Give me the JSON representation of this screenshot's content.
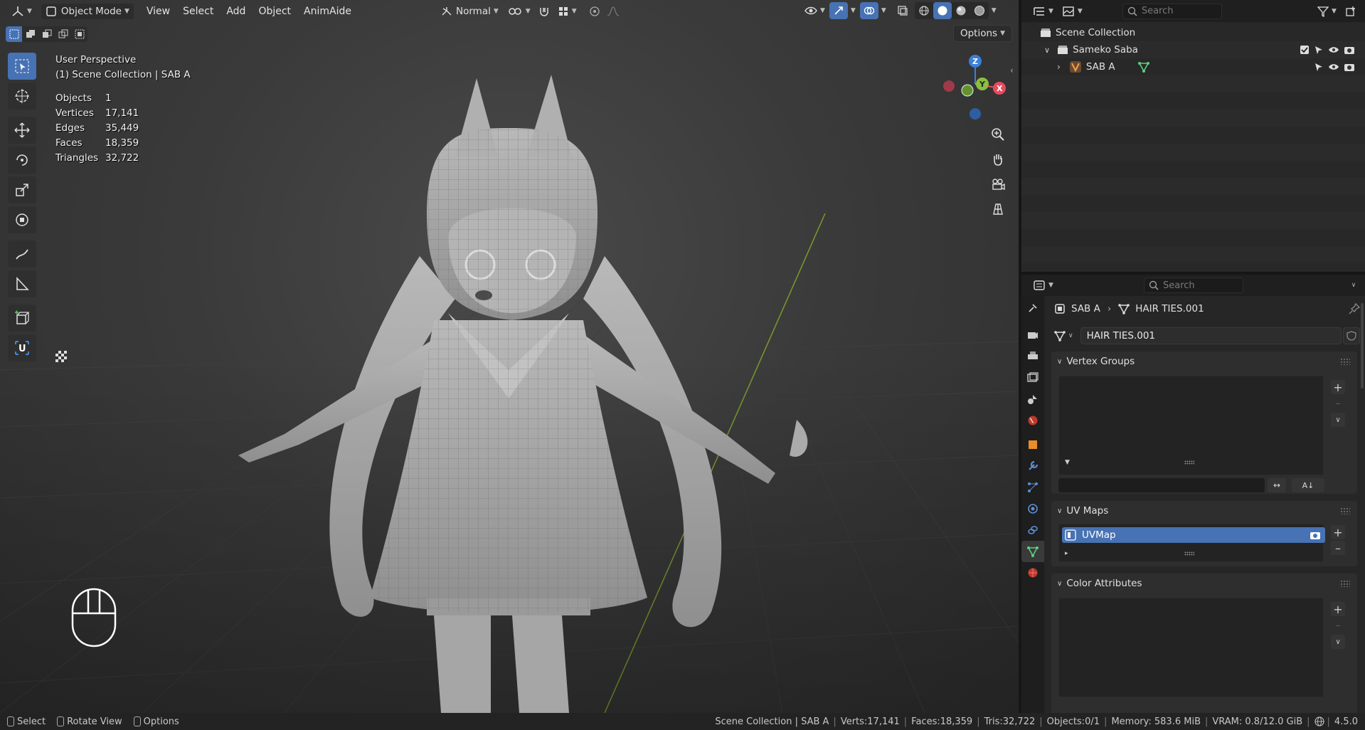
{
  "viewport": {
    "header": {
      "editor_icon": "axis-icon",
      "mode_label": "Object Mode",
      "menus": [
        "View",
        "Select",
        "Add",
        "Object",
        "AnimAide"
      ],
      "orientation_label": "Normal"
    },
    "options_label": "Options",
    "overlay_title": "User Perspective",
    "overlay_collection": "(1) Scene Collection | SAB  A",
    "stats": [
      {
        "label": "Objects",
        "value": "1"
      },
      {
        "label": "Vertices",
        "value": "17,141"
      },
      {
        "label": "Edges",
        "value": "35,449"
      },
      {
        "label": "Faces",
        "value": "18,359"
      },
      {
        "label": "Triangles",
        "value": "32,722"
      }
    ],
    "gizmo": {
      "z": "Z",
      "y": "Y",
      "x": "X"
    }
  },
  "statusbar": {
    "left": [
      {
        "label": "Select"
      },
      {
        "label": "Rotate View"
      },
      {
        "label": "Options"
      }
    ],
    "right": [
      "Scene Collection | SAB  A",
      "Verts:17,141",
      "Faces:18,359",
      "Tris:32,722",
      "Objects:0/1",
      "Memory: 583.6 MiB",
      "VRAM: 0.8/12.0 GiB",
      "4.5.0"
    ]
  },
  "outliner": {
    "search_placeholder": "Search",
    "rows": [
      {
        "label": "Scene Collection"
      },
      {
        "label": "Sameko Saba"
      },
      {
        "label": "SAB  A"
      }
    ]
  },
  "properties": {
    "search_placeholder": "Search",
    "breadcrumb": {
      "object": "SAB  A",
      "data": "HAIR TIES.001"
    },
    "datablock_name": "HAIR TIES.001",
    "panels": {
      "vertex_groups": "Vertex Groups",
      "uv_maps": "UV Maps",
      "uv_map_item": "UVMap",
      "color_attributes": "Color Attributes"
    }
  },
  "colors": {
    "accent": "#4772b3",
    "axis_x": "#e84a5f",
    "axis_y": "#8cbf3f",
    "axis_z": "#3b7fd6"
  }
}
